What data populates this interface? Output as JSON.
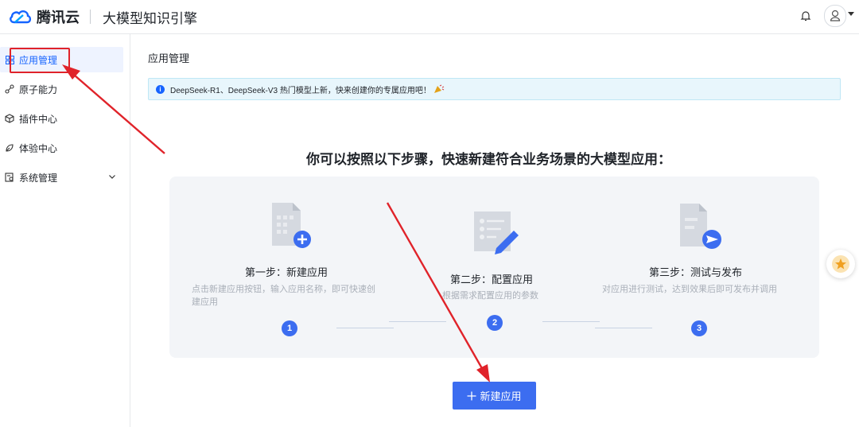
{
  "header": {
    "brand": "腾讯云",
    "product": "大模型知识引擎"
  },
  "sidebar": {
    "items": [
      {
        "label": "应用管理",
        "icon": "grid-icon",
        "active": true
      },
      {
        "label": "原子能力",
        "icon": "link-icon",
        "active": false
      },
      {
        "label": "插件中心",
        "icon": "cube-icon",
        "active": false
      },
      {
        "label": "体验中心",
        "icon": "leaf-icon",
        "active": false
      },
      {
        "label": "系统管理",
        "icon": "settings-doc-icon",
        "active": false,
        "expandable": true
      }
    ]
  },
  "main": {
    "title": "应用管理",
    "notice": "DeepSeek-R1、DeepSeek-V3 热门模型上新，快来创建你的专属应用吧！",
    "heading": "你可以按照以下步骤，快速新建符合业务场景的大模型应用：",
    "steps": [
      {
        "num": "1",
        "title": "第一步：新建应用",
        "desc": "点击新建应用按钮，输入应用名称，即可快速创建应用"
      },
      {
        "num": "2",
        "title": "第二步：配置应用",
        "desc": "根据需求配置应用的参数"
      },
      {
        "num": "3",
        "title": "第三步：测试与发布",
        "desc": "对应用进行测试，达到效果后即可发布并调用"
      }
    ],
    "new_button": "新建应用"
  },
  "colors": {
    "accent": "#3c6df0",
    "active_nav": "#1664ff",
    "annotation": "#e0232a"
  }
}
